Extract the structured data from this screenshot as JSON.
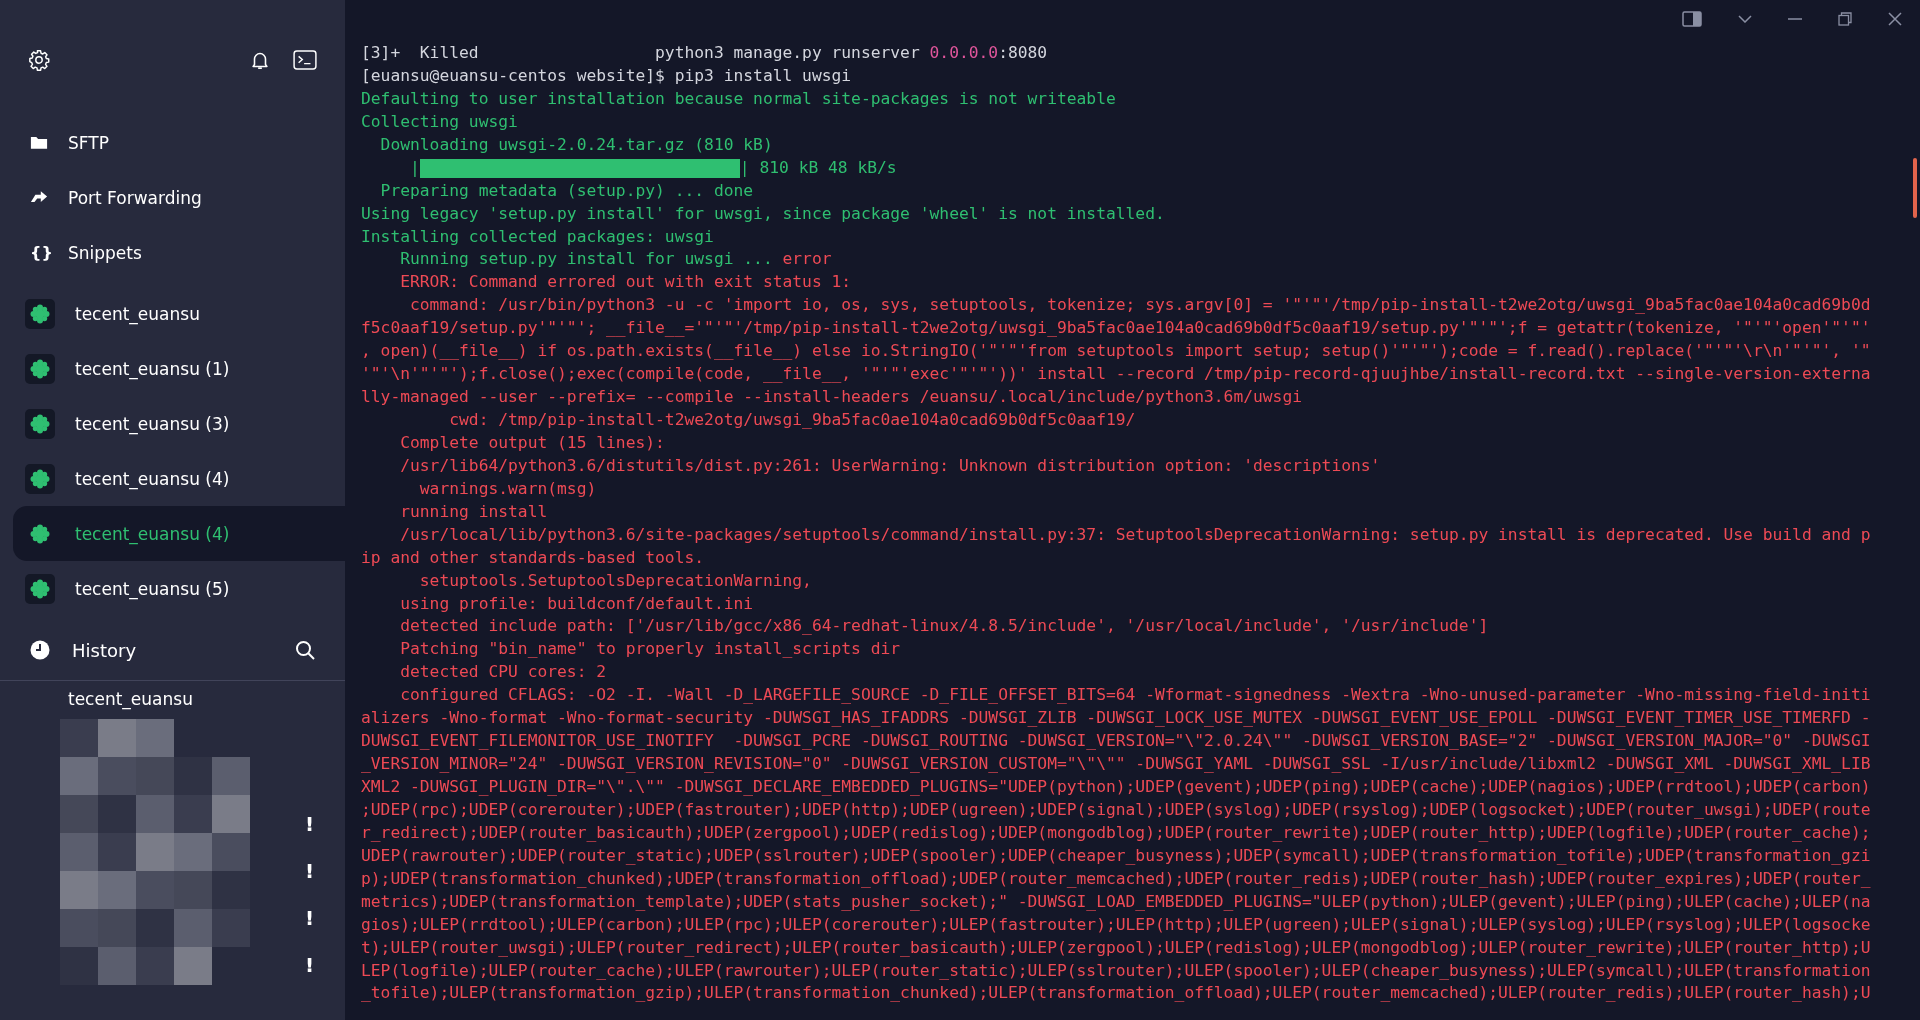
{
  "sidebar": {
    "nav": [
      {
        "label": "SFTP",
        "kind": "folder"
      },
      {
        "label": "Port Forwarding",
        "kind": "forward"
      },
      {
        "label": "Snippets",
        "kind": "glyph",
        "glyph": "{}"
      }
    ],
    "hosts": [
      {
        "label": "tecent_euansu",
        "selected": false
      },
      {
        "label": "tecent_euansu (1)",
        "selected": false
      },
      {
        "label": "tecent_euansu (3)",
        "selected": false
      },
      {
        "label": "tecent_euansu (4)",
        "selected": false
      },
      {
        "label": "tecent_euansu (4)",
        "selected": true
      },
      {
        "label": "tecent_euansu (5)",
        "selected": false
      }
    ],
    "history": {
      "title": "History",
      "items": [
        "tecent_euansu"
      ],
      "alerts": [
        "!",
        "!",
        "!",
        "!"
      ]
    }
  },
  "terminal": {
    "lines": [
      {
        "segments": [
          {
            "text": "[3]+  Killed                  python3 manage.py runserver ",
            "color": "#d4d6de"
          },
          {
            "text": "0.0.0.0",
            "color": "#e0559b"
          },
          {
            "text": ":8080",
            "color": "#d4d6de"
          }
        ]
      },
      {
        "color": "#d4d6de",
        "text": "[euansu@euansu-centos website]$ pip3 install uwsgi"
      },
      {
        "color": "#2fbf71",
        "text": "Defaulting to user installation because normal site-packages is not writeable"
      },
      {
        "color": "#2fbf71",
        "text": "Collecting uwsgi"
      },
      {
        "color": "#2fbf71",
        "text": "  Downloading uwsgi-2.0.24.tar.gz (810 kB)"
      },
      {
        "kind": "progress",
        "color": "#2fbf71",
        "prefix": "     |",
        "suffix": "| 810 kB 48 kB/s"
      },
      {
        "color": "#2fbf71",
        "text": "  Preparing metadata (setup.py) ... done"
      },
      {
        "color": "#2fbf71",
        "text": "Using legacy 'setup.py install' for uwsgi, since package 'wheel' is not installed."
      },
      {
        "color": "#2fbf71",
        "text": "Installing collected packages: uwsgi"
      },
      {
        "segments": [
          {
            "text": "    Running setup.py install for uwsgi ... ",
            "color": "#2fbf71"
          },
          {
            "text": "error",
            "color": "#ee4a55"
          }
        ]
      },
      {
        "color": "#ee4a55",
        "text": "    ERROR: Command errored out with exit status 1:"
      },
      {
        "color": "#ee4a55",
        "text": "     command: /usr/bin/python3 -u -c 'import io, os, sys, setuptools, tokenize; sys.argv[0] = '\"'\"'/tmp/pip-install-t2we2otg/uwsgi_9ba5fac0ae104a0cad69b0d"
      },
      {
        "color": "#ee4a55",
        "text": "f5c0aaf19/setup.py'\"'\"'; __file__='\"'\"'/tmp/pip-install-t2we2otg/uwsgi_9ba5fac0ae104a0cad69b0df5c0aaf19/setup.py'\"'\"';f = getattr(tokenize, '\"'\"'open'\"'\"'"
      },
      {
        "color": "#ee4a55",
        "text": ", open)(__file__) if os.path.exists(__file__) else io.StringIO('\"'\"'from setuptools import setup; setup()'\"'\"');code = f.read().replace('\"'\"'\\r\\n'\"'\"', '\""
      },
      {
        "color": "#ee4a55",
        "text": "'\"'\\n'\"'\"');f.close();exec(compile(code, __file__, '\"'\"'exec'\"'\"'))' install --record /tmp/pip-record-qjuujhbe/install-record.txt --single-version-externa"
      },
      {
        "color": "#ee4a55",
        "text": "lly-managed --user --prefix= --compile --install-headers /euansu/.local/include/python3.6m/uwsgi"
      },
      {
        "color": "#ee4a55",
        "text": "         cwd: /tmp/pip-install-t2we2otg/uwsgi_9ba5fac0ae104a0cad69b0df5c0aaf19/"
      },
      {
        "color": "#ee4a55",
        "text": "    Complete output (15 lines):"
      },
      {
        "color": "#ee4a55",
        "text": "    /usr/lib64/python3.6/distutils/dist.py:261: UserWarning: Unknown distribution option: 'descriptions'"
      },
      {
        "color": "#ee4a55",
        "text": "      warnings.warn(msg)"
      },
      {
        "color": "#ee4a55",
        "text": "    running install"
      },
      {
        "color": "#ee4a55",
        "text": "    /usr/local/lib/python3.6/site-packages/setuptools/command/install.py:37: SetuptoolsDeprecationWarning: setup.py install is deprecated. Use build and p"
      },
      {
        "color": "#ee4a55",
        "text": "ip and other standards-based tools."
      },
      {
        "color": "#ee4a55",
        "text": "      setuptools.SetuptoolsDeprecationWarning,"
      },
      {
        "color": "#ee4a55",
        "text": "    using profile: buildconf/default.ini"
      },
      {
        "color": "#ee4a55",
        "text": "    detected include path: ['/usr/lib/gcc/x86_64-redhat-linux/4.8.5/include', '/usr/local/include', '/usr/include']"
      },
      {
        "color": "#ee4a55",
        "text": "    Patching \"bin_name\" to properly install_scripts dir"
      },
      {
        "color": "#ee4a55",
        "text": "    detected CPU cores: 2"
      },
      {
        "color": "#ee4a55",
        "text": "    configured CFLAGS: -O2 -I. -Wall -D_LARGEFILE_SOURCE -D_FILE_OFFSET_BITS=64 -Wformat-signedness -Wextra -Wno-unused-parameter -Wno-missing-field-initi"
      },
      {
        "color": "#ee4a55",
        "text": "alizers -Wno-format -Wno-format-security -DUWSGI_HAS_IFADDRS -DUWSGI_ZLIB -DUWSGI_LOCK_USE_MUTEX -DUWSGI_EVENT_USE_EPOLL -DUWSGI_EVENT_TIMER_USE_TIMERFD -"
      },
      {
        "color": "#ee4a55",
        "text": "DUWSGI_EVENT_FILEMONITOR_USE_INOTIFY  -DUWSGI_PCRE -DUWSGI_ROUTING -DUWSGI_VERSION=\"\\\"2.0.24\\\"\" -DUWSGI_VERSION_BASE=\"2\" -DUWSGI_VERSION_MAJOR=\"0\" -DUWSGI"
      },
      {
        "color": "#ee4a55",
        "text": "_VERSION_MINOR=\"24\" -DUWSGI_VERSION_REVISION=\"0\" -DUWSGI_VERSION_CUSTOM=\"\\\"\\\"\" -DUWSGI_YAML -DUWSGI_SSL -I/usr/include/libxml2 -DUWSGI_XML -DUWSGI_XML_LIB"
      },
      {
        "color": "#ee4a55",
        "text": "XML2 -DUWSGI_PLUGIN_DIR=\"\\\".\\\"\" -DUWSGI_DECLARE_EMBEDDED_PLUGINS=\"UDEP(python);UDEP(gevent);UDEP(ping);UDEP(cache);UDEP(nagios);UDEP(rrdtool);UDEP(carbon)"
      },
      {
        "color": "#ee4a55",
        "text": ";UDEP(rpc);UDEP(corerouter);UDEP(fastrouter);UDEP(http);UDEP(ugreen);UDEP(signal);UDEP(syslog);UDEP(rsyslog);UDEP(logsocket);UDEP(router_uwsgi);UDEP(route"
      },
      {
        "color": "#ee4a55",
        "text": "r_redirect);UDEP(router_basicauth);UDEP(zergpool);UDEP(redislog);UDEP(mongodblog);UDEP(router_rewrite);UDEP(router_http);UDEP(logfile);UDEP(router_cache);"
      },
      {
        "color": "#ee4a55",
        "text": "UDEP(rawrouter);UDEP(router_static);UDEP(sslrouter);UDEP(spooler);UDEP(cheaper_busyness);UDEP(symcall);UDEP(transformation_tofile);UDEP(transformation_gzi"
      },
      {
        "color": "#ee4a55",
        "text": "p);UDEP(transformation_chunked);UDEP(transformation_offload);UDEP(router_memcached);UDEP(router_redis);UDEP(router_hash);UDEP(router_expires);UDEP(router_"
      },
      {
        "color": "#ee4a55",
        "text": "metrics);UDEP(transformation_template);UDEP(stats_pusher_socket);\" -DUWSGI_LOAD_EMBEDDED_PLUGINS=\"ULEP(python);ULEP(gevent);ULEP(ping);ULEP(cache);ULEP(na"
      },
      {
        "color": "#ee4a55",
        "text": "gios);ULEP(rrdtool);ULEP(carbon);ULEP(rpc);ULEP(corerouter);ULEP(fastrouter);ULEP(http);ULEP(ugreen);ULEP(signal);ULEP(syslog);ULEP(rsyslog);ULEP(logsocke"
      },
      {
        "color": "#ee4a55",
        "text": "t);ULEP(router_uwsgi);ULEP(router_redirect);ULEP(router_basicauth);ULEP(zergpool);ULEP(redislog);ULEP(mongodblog);ULEP(router_rewrite);ULEP(router_http);U"
      },
      {
        "color": "#ee4a55",
        "text": "LEP(logfile);ULEP(router_cache);ULEP(rawrouter);ULEP(router_static);ULEP(sslrouter);ULEP(spooler);ULEP(cheaper_busyness);ULEP(symcall);ULEP(transformation"
      },
      {
        "color": "#ee4a55",
        "text": "_tofile);ULEP(transformation_gzip);ULEP(transformation_chunked);ULEP(transformation_offload);ULEP(router_memcached);ULEP(router_redis);ULEP(router_hash);U"
      }
    ]
  }
}
